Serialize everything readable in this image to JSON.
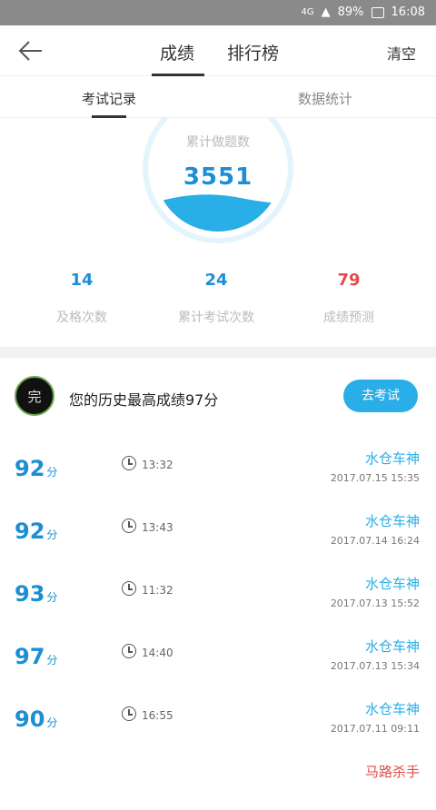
{
  "status_bar": {
    "network": "4G",
    "battery": "89%",
    "time": "16:08"
  },
  "header": {
    "tabs": [
      "成绩",
      "排行榜"
    ],
    "active_tab": "成绩",
    "clear_label": "清空"
  },
  "subtabs": {
    "items": [
      "考试记录",
      "数据统计"
    ],
    "active": "考试记录"
  },
  "summary": {
    "total_label": "累计做题数",
    "total_value": "3551",
    "stats": [
      {
        "value": "14",
        "label": "及格次数",
        "color": "#1b8ed4"
      },
      {
        "value": "24",
        "label": "累计考试次数",
        "color": "#1b8ed4"
      },
      {
        "value": "79",
        "label": "成绩预测",
        "color": "#e24a4a"
      }
    ]
  },
  "best": {
    "avatar_text": "完",
    "text": "您的历史最高成绩97分",
    "button_label": "去考试"
  },
  "records": [
    {
      "score": "92",
      "unit": "分",
      "duration": "13:32",
      "rank": "水仓车神",
      "date": "2017.07.15    15:35",
      "rank_color": "#29aee8"
    },
    {
      "score": "92",
      "unit": "分",
      "duration": "13:43",
      "rank": "水仓车神",
      "date": "2017.07.14    16:24",
      "rank_color": "#29aee8"
    },
    {
      "score": "93",
      "unit": "分",
      "duration": "11:32",
      "rank": "水仓车神",
      "date": "2017.07.13    15:52",
      "rank_color": "#29aee8"
    },
    {
      "score": "97",
      "unit": "分",
      "duration": "14:40",
      "rank": "水仓车神",
      "date": "2017.07.13    15:34",
      "rank_color": "#29aee8"
    },
    {
      "score": "90",
      "unit": "分",
      "duration": "16:55",
      "rank": "水仓车神",
      "date": "2017.07.11    09:11",
      "rank_color": "#29aee8"
    },
    {
      "score": "",
      "unit": "",
      "duration": "",
      "rank": "马路杀手",
      "date": "",
      "rank_color": "#e24a4a"
    }
  ],
  "colors": {
    "accent": "#29aee8",
    "score_blue": "#1b8ed4",
    "danger": "#e24a4a",
    "gauge_fill": "#29aee8",
    "gauge_ring": "#e3f4fc"
  }
}
